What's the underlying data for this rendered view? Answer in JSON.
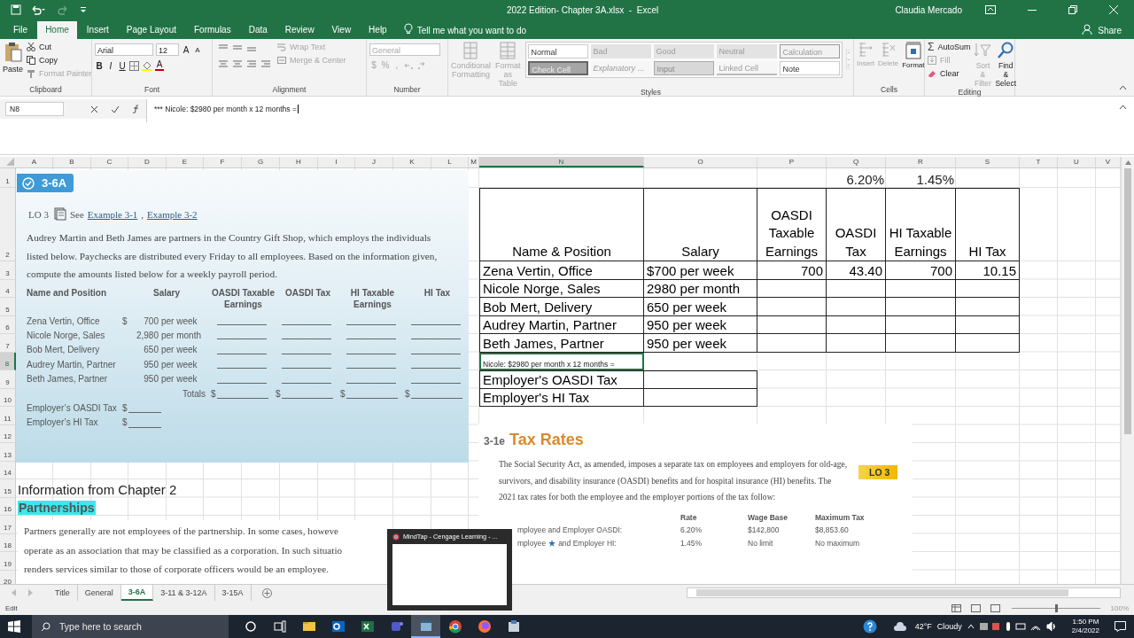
{
  "title_bar": {
    "title": "2022 Edition- Chapter 3A.xlsx  -  Excel",
    "user": "Claudia Mercado",
    "redo_disabled": true
  },
  "tabs": [
    {
      "label": "File",
      "selected": false
    },
    {
      "label": "Home",
      "selected": true
    },
    {
      "label": "Insert",
      "selected": false
    },
    {
      "label": "Page Layout",
      "selected": false
    },
    {
      "label": "Formulas",
      "selected": false
    },
    {
      "label": "Data",
      "selected": false
    },
    {
      "label": "Review",
      "selected": false
    },
    {
      "label": "View",
      "selected": false
    },
    {
      "label": "Help",
      "selected": false
    }
  ],
  "tell_me": "Tell me what you want to do",
  "share": "Share",
  "ribbon": {
    "clipboard": {
      "label": "Clipboard",
      "paste": "Paste",
      "cut": "Cut",
      "copy": "Copy",
      "format_painter": {
        "label": "Format Painter",
        "disabled": true
      }
    },
    "font": {
      "label": "Font",
      "name": "Arial",
      "size": "12",
      "grow": "A",
      "shrink": "A",
      "styles": [
        "B",
        "I",
        "U"
      ],
      "color_letter": "A"
    },
    "alignment": {
      "label": "Alignment",
      "wrap": {
        "label": "Wrap Text",
        "disabled": true
      },
      "merge": {
        "label": "Merge & Center",
        "disabled": true
      }
    },
    "number": {
      "label": "Number",
      "format": {
        "label": "General",
        "disabled": true
      },
      "symbols": [
        "$",
        "%",
        ","
      ]
    },
    "styles": {
      "label": "Styles",
      "conditional": {
        "label": "Conditional Formatting",
        "disabled": true
      },
      "format_table": {
        "label": "Format as Table",
        "disabled": true
      },
      "gallery": [
        {
          "label": "Normal",
          "kind": "normal"
        },
        {
          "label": "Bad",
          "kind": "muted"
        },
        {
          "label": "Good",
          "kind": "muted"
        },
        {
          "label": "Neutral",
          "kind": "muted"
        },
        {
          "label": "Calculation",
          "kind": "calc"
        },
        {
          "label": "Check Cell",
          "kind": "check"
        },
        {
          "label": "Explanatory ...",
          "kind": "italic"
        },
        {
          "label": "Input",
          "kind": "input"
        },
        {
          "label": "Linked Cell",
          "kind": "linked"
        },
        {
          "label": "Note",
          "kind": "note"
        }
      ]
    },
    "cells": {
      "label": "Cells",
      "buttons": [
        {
          "label": "Insert",
          "kind": "insert",
          "disabled": true
        },
        {
          "label": "Delete",
          "kind": "delete",
          "disabled": true
        },
        {
          "label": "Format",
          "kind": "format",
          "disabled": false
        }
      ]
    },
    "editing": {
      "label": "Editing",
      "sigma": "Σ",
      "autosum": {
        "label": "AutoSum",
        "disabled": false
      },
      "fill": {
        "label": "Fill",
        "disabled": true
      },
      "clear": {
        "label": "Clear",
        "disabled": false
      },
      "sort": {
        "label": "Sort & Filter",
        "disabled": true
      },
      "find": {
        "label": "Find & Select",
        "disabled": false
      }
    }
  },
  "formula_bar": {
    "name_box": "N8",
    "formula": "*** Nicole: $2980 per month x 12 months ="
  },
  "sheet": {
    "column_headers": [
      {
        "label": "A",
        "selected": false
      },
      {
        "label": "B",
        "selected": false
      },
      {
        "label": "C",
        "selected": false
      },
      {
        "label": "D",
        "selected": false
      },
      {
        "label": "E",
        "selected": false
      },
      {
        "label": "F",
        "selected": false
      },
      {
        "label": "G",
        "selected": false
      },
      {
        "label": "H",
        "selected": false
      },
      {
        "label": "I",
        "selected": false
      },
      {
        "label": "J",
        "selected": false
      },
      {
        "label": "K",
        "selected": false
      },
      {
        "label": "L",
        "selected": false
      },
      {
        "label": "M",
        "selected": false
      },
      {
        "label": "N",
        "selected": true
      },
      {
        "label": "O",
        "selected": false
      },
      {
        "label": "P",
        "selected": false
      },
      {
        "label": "Q",
        "selected": false
      },
      {
        "label": "R",
        "selected": false
      },
      {
        "label": "S",
        "selected": false
      },
      {
        "label": "T",
        "selected": false
      },
      {
        "label": "U",
        "selected": false
      },
      {
        "label": "V",
        "selected": false
      }
    ],
    "row_headers": [
      {
        "label": "1",
        "selected": false
      },
      {
        "label": "2",
        "selected": false
      },
      {
        "label": "3",
        "selected": false
      },
      {
        "label": "4",
        "selected": false
      },
      {
        "label": "5",
        "selected": false
      },
      {
        "label": "6",
        "selected": false
      },
      {
        "label": "7",
        "selected": false
      },
      {
        "label": "8",
        "selected": true
      },
      {
        "label": "9",
        "selected": false
      },
      {
        "label": "10",
        "selected": false
      },
      {
        "label": "11",
        "selected": false
      },
      {
        "label": "12",
        "selected": false
      },
      {
        "label": "13",
        "selected": false
      },
      {
        "label": "14",
        "selected": false
      },
      {
        "label": "15",
        "selected": false
      },
      {
        "label": "16",
        "selected": false
      },
      {
        "label": "17",
        "selected": false
      },
      {
        "label": "18",
        "selected": false
      },
      {
        "label": "19",
        "selected": false
      },
      {
        "label": "20",
        "selected": false
      }
    ],
    "rates": [
      "6.20%",
      "1.45%"
    ],
    "table": {
      "columns": [
        "Name & Position",
        "Salary",
        "OASDI Taxable Earnings",
        "OASDI Tax",
        "HI Taxable Earnings",
        "HI Tax"
      ],
      "rows": [
        {
          "name": "Zena Vertin, Office",
          "salary": "$700 per week",
          "oasdi_taxable": "700",
          "oasdi_tax": "43.40",
          "hi_taxable": "700",
          "hi_tax": "10.15"
        },
        {
          "name": "Nicole Norge, Sales",
          "salary": "2980 per month"
        },
        {
          "name": "Bob Mert, Delivery",
          "salary": "650 per week"
        },
        {
          "name": "Audrey Martin, Partner",
          "salary": "950 per week"
        },
        {
          "name": "Beth James, Partner",
          "salary": "950 per week"
        }
      ]
    },
    "active_cell": "Nicole: $2980 per month x 12 months =",
    "employer_rows": [
      "Employer's OASDI Tax",
      "Employer's HI Tax"
    ],
    "heading": "Information from Chapter 2",
    "subheading": "Partnerships"
  },
  "problem": {
    "badge": "3-6A",
    "lo": "LO 3",
    "see": "See",
    "links": [
      "Example 3-1",
      "Example 3-2"
    ],
    "link_separator": ",",
    "text": "Audrey Martin and Beth James are partners in the Country Gift Shop, which employs the individuals listed below. Paychecks are distributed every Friday to all employees. Based on the information given, compute the amounts listed below for a weekly payroll period.",
    "columns": [
      "Name and Position",
      "Salary",
      "OASDI Taxable Earnings",
      "OASDI Tax",
      "HI Taxable Earnings",
      "HI Tax"
    ],
    "rows": [
      {
        "name": "Zena Vertin, Office",
        "currency": "$",
        "amount": "700",
        "unit": "per week"
      },
      {
        "name": "Nicole Norge, Sales",
        "amount": "2,980",
        "unit": "per month"
      },
      {
        "name": "Bob Mert, Delivery",
        "amount": "650",
        "unit": "per week"
      },
      {
        "name": "Audrey Martin, Partner",
        "amount": "950",
        "unit": "per week"
      },
      {
        "name": "Beth James, Partner",
        "amount": "950",
        "unit": "per week"
      }
    ],
    "totals_label": "Totals",
    "totals_currency": [
      "$",
      "$",
      "$",
      "$"
    ],
    "employer": [
      {
        "label": "Employer’s OASDI Tax",
        "currency": "$"
      },
      {
        "label": "Employer’s HI Tax",
        "currency": "$"
      }
    ]
  },
  "chapter_text": [
    "Partners generally are not employees of the partnership. In some cases, howeve",
    "operate as an association that may be classified as a corporation. In such situatio",
    "renders services similar to those of corporate officers would be an employee."
  ],
  "tax_rates": {
    "section": "3-1e",
    "title": "Tax Rates",
    "badge": "LO 3",
    "text": "The Social Security Act, as amended, imposes a separate tax on employees and employers for old-age, survivors, and disability insurance (OASDI) benefits and for hospital insurance (HI) benefits. The 2021 tax rates for both the employee and the employer portions of the tax follow:",
    "columns": [
      "Rate",
      "Wage Base",
      "Maximum Tax"
    ],
    "rows": [
      {
        "label": [
          "mployee and Employer OASDI:"
        ],
        "rate": "6.20%",
        "wage_base": "$142,800",
        "maximum": "$8,853.60"
      },
      {
        "label": [
          "mployee",
          "and Employer HI:"
        ],
        "rate": "1.45%",
        "wage_base": "No limit",
        "maximum": "No maximum"
      }
    ]
  },
  "popup": {
    "title": "MindTap - Cengage Learning - ..."
  },
  "sheet_tabs": [
    {
      "label": "Title",
      "selected": false
    },
    {
      "label": "General",
      "selected": false
    },
    {
      "label": "3-6A",
      "selected": true
    },
    {
      "label": "3-11 & 3-12A",
      "selected": false
    },
    {
      "label": "3-15A",
      "selected": false
    }
  ],
  "status_bar": {
    "mode": "Edit",
    "zoom": "100%",
    "zoom_slider": {
      "level": 0.5
    }
  },
  "taskbar": {
    "search": "Type here to search",
    "apps": [
      {
        "kind": "cortana",
        "selected": false
      },
      {
        "kind": "taskview",
        "selected": false
      },
      {
        "kind": "explorer",
        "selected": false
      },
      {
        "kind": "outlook",
        "selected": false
      },
      {
        "kind": "excel",
        "selected": false
      },
      {
        "kind": "teams",
        "selected": false
      },
      {
        "kind": "window",
        "selected": true
      },
      {
        "kind": "chrome",
        "selected": false
      },
      {
        "kind": "firefox",
        "selected": false
      },
      {
        "kind": "tool",
        "selected": false
      }
    ],
    "temperature": "42°F",
    "weather": "Cloudy",
    "time": "1:50 PM",
    "date": "2/4/2022"
  }
}
